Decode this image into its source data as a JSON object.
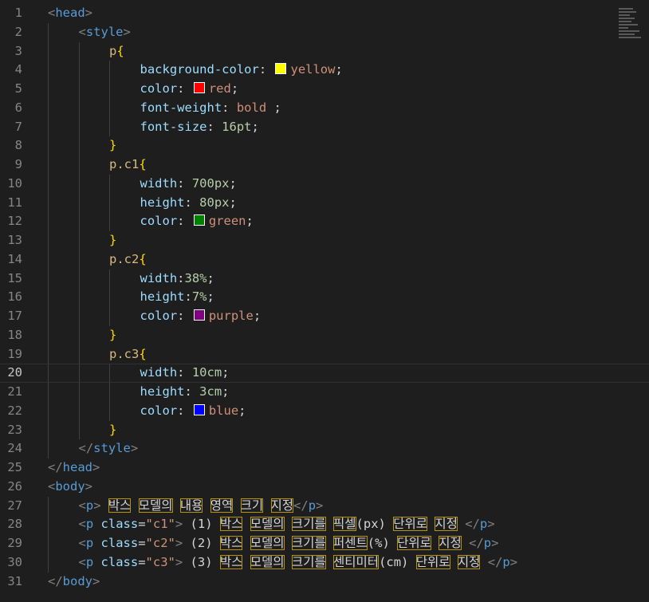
{
  "editor": {
    "lines": [
      {
        "n": "1",
        "indent": 0,
        "tokens": [
          {
            "t": "<",
            "c": "brk"
          },
          {
            "t": "head",
            "c": "tag"
          },
          {
            "t": ">",
            "c": "brk"
          }
        ]
      },
      {
        "n": "2",
        "indent": 1,
        "tokens": [
          {
            "t": "<",
            "c": "brk"
          },
          {
            "t": "style",
            "c": "tag"
          },
          {
            "t": ">",
            "c": "brk"
          }
        ]
      },
      {
        "n": "3",
        "indent": 2,
        "tokens": [
          {
            "t": "p",
            "c": "sel"
          },
          {
            "t": "{",
            "c": "brace"
          }
        ]
      },
      {
        "n": "4",
        "indent": 3,
        "tokens": [
          {
            "t": "background-color",
            "c": "prop"
          },
          {
            "t": ": ",
            "c": "txt"
          },
          {
            "swatch": "#ffff00",
            "name": "yellow-swatch"
          },
          {
            "t": "yellow",
            "c": "val"
          },
          {
            "t": ";",
            "c": "txt"
          }
        ]
      },
      {
        "n": "5",
        "indent": 3,
        "tokens": [
          {
            "t": "color",
            "c": "prop"
          },
          {
            "t": ": ",
            "c": "txt"
          },
          {
            "swatch": "#ff0000",
            "name": "red-swatch"
          },
          {
            "t": "red",
            "c": "val"
          },
          {
            "t": ";",
            "c": "txt"
          }
        ]
      },
      {
        "n": "6",
        "indent": 3,
        "tokens": [
          {
            "t": "font-weight",
            "c": "prop"
          },
          {
            "t": ": ",
            "c": "txt"
          },
          {
            "t": "bold",
            "c": "val"
          },
          {
            "t": " ;",
            "c": "txt"
          }
        ]
      },
      {
        "n": "7",
        "indent": 3,
        "tokens": [
          {
            "t": "font-size",
            "c": "prop"
          },
          {
            "t": ": ",
            "c": "txt"
          },
          {
            "t": "16pt",
            "c": "num"
          },
          {
            "t": ";",
            "c": "txt"
          }
        ]
      },
      {
        "n": "8",
        "indent": 2,
        "tokens": [
          {
            "t": "}",
            "c": "brace"
          }
        ]
      },
      {
        "n": "9",
        "indent": 2,
        "tokens": [
          {
            "t": "p.c1",
            "c": "sel"
          },
          {
            "t": "{",
            "c": "brace"
          }
        ]
      },
      {
        "n": "10",
        "indent": 3,
        "tokens": [
          {
            "t": "width",
            "c": "prop"
          },
          {
            "t": ": ",
            "c": "txt"
          },
          {
            "t": "700px",
            "c": "num"
          },
          {
            "t": ";",
            "c": "txt"
          }
        ]
      },
      {
        "n": "11",
        "indent": 3,
        "tokens": [
          {
            "t": "height",
            "c": "prop"
          },
          {
            "t": ": ",
            "c": "txt"
          },
          {
            "t": "80px",
            "c": "num"
          },
          {
            "t": ";",
            "c": "txt"
          }
        ]
      },
      {
        "n": "12",
        "indent": 3,
        "tokens": [
          {
            "t": "color",
            "c": "prop"
          },
          {
            "t": ": ",
            "c": "txt"
          },
          {
            "swatch": "#008000",
            "name": "green-swatch"
          },
          {
            "t": "green",
            "c": "val"
          },
          {
            "t": ";",
            "c": "txt"
          }
        ]
      },
      {
        "n": "13",
        "indent": 2,
        "tokens": [
          {
            "t": "}",
            "c": "brace"
          }
        ]
      },
      {
        "n": "14",
        "indent": 2,
        "tokens": [
          {
            "t": "p.c2",
            "c": "sel"
          },
          {
            "t": "{",
            "c": "brace"
          }
        ]
      },
      {
        "n": "15",
        "indent": 3,
        "tokens": [
          {
            "t": "width",
            "c": "prop"
          },
          {
            "t": ":",
            "c": "txt"
          },
          {
            "t": "38%",
            "c": "num"
          },
          {
            "t": ";",
            "c": "txt"
          }
        ]
      },
      {
        "n": "16",
        "indent": 3,
        "tokens": [
          {
            "t": "height",
            "c": "prop"
          },
          {
            "t": ":",
            "c": "txt"
          },
          {
            "t": "7%",
            "c": "num"
          },
          {
            "t": ";",
            "c": "txt"
          }
        ]
      },
      {
        "n": "17",
        "indent": 3,
        "tokens": [
          {
            "t": "color",
            "c": "prop"
          },
          {
            "t": ": ",
            "c": "txt"
          },
          {
            "swatch": "#800080",
            "name": "purple-swatch"
          },
          {
            "t": "purple",
            "c": "val"
          },
          {
            "t": ";",
            "c": "txt"
          }
        ]
      },
      {
        "n": "18",
        "indent": 2,
        "tokens": [
          {
            "t": "}",
            "c": "brace"
          }
        ]
      },
      {
        "n": "19",
        "indent": 2,
        "tokens": [
          {
            "t": "p.c3",
            "c": "sel"
          },
          {
            "t": "{",
            "c": "brace"
          }
        ]
      },
      {
        "n": "20",
        "indent": 3,
        "current": true,
        "tokens": [
          {
            "t": "width",
            "c": "prop"
          },
          {
            "t": ": ",
            "c": "txt"
          },
          {
            "t": "10cm",
            "c": "num"
          },
          {
            "t": ";",
            "c": "txt"
          }
        ]
      },
      {
        "n": "21",
        "indent": 3,
        "tokens": [
          {
            "t": "height",
            "c": "prop"
          },
          {
            "t": ": ",
            "c": "txt"
          },
          {
            "t": "3cm",
            "c": "num"
          },
          {
            "t": ";",
            "c": "txt"
          }
        ]
      },
      {
        "n": "22",
        "indent": 3,
        "tokens": [
          {
            "t": "color",
            "c": "prop"
          },
          {
            "t": ": ",
            "c": "txt"
          },
          {
            "swatch": "#0000ff",
            "name": "blue-swatch"
          },
          {
            "t": "blue",
            "c": "val"
          },
          {
            "t": ";",
            "c": "txt"
          }
        ]
      },
      {
        "n": "23",
        "indent": 2,
        "tokens": [
          {
            "t": "}",
            "c": "brace"
          }
        ]
      },
      {
        "n": "24",
        "indent": 1,
        "tokens": [
          {
            "t": "</",
            "c": "brk"
          },
          {
            "t": "style",
            "c": "tag"
          },
          {
            "t": ">",
            "c": "brk"
          }
        ]
      },
      {
        "n": "25",
        "indent": 0,
        "tokens": [
          {
            "t": "</",
            "c": "brk"
          },
          {
            "t": "head",
            "c": "tag"
          },
          {
            "t": ">",
            "c": "brk"
          }
        ]
      },
      {
        "n": "26",
        "indent": 0,
        "tokens": [
          {
            "t": "<",
            "c": "brk"
          },
          {
            "t": "body",
            "c": "tag"
          },
          {
            "t": ">",
            "c": "brk"
          }
        ]
      },
      {
        "n": "27",
        "indent": 1,
        "tokens": [
          {
            "t": "<",
            "c": "brk"
          },
          {
            "t": "p",
            "c": "tag"
          },
          {
            "t": ">",
            "c": "brk"
          },
          {
            "t": " ",
            "c": "txt"
          },
          {
            "t": "박스",
            "c": "txt",
            "hl": true
          },
          {
            "t": " ",
            "c": "txt"
          },
          {
            "t": "모델의",
            "c": "txt",
            "hl": true
          },
          {
            "t": " ",
            "c": "txt"
          },
          {
            "t": "내용",
            "c": "txt",
            "hl": true
          },
          {
            "t": " ",
            "c": "txt"
          },
          {
            "t": "영역",
            "c": "txt",
            "hl": true
          },
          {
            "t": " ",
            "c": "txt"
          },
          {
            "t": "크기",
            "c": "txt",
            "hl": true
          },
          {
            "t": " ",
            "c": "txt"
          },
          {
            "t": "지정",
            "c": "txt",
            "hl": true
          },
          {
            "t": "</",
            "c": "brk"
          },
          {
            "t": "p",
            "c": "tag"
          },
          {
            "t": ">",
            "c": "brk"
          }
        ]
      },
      {
        "n": "28",
        "indent": 1,
        "tokens": [
          {
            "t": "<",
            "c": "brk"
          },
          {
            "t": "p",
            "c": "tag"
          },
          {
            "t": " ",
            "c": "txt"
          },
          {
            "t": "class",
            "c": "attr"
          },
          {
            "t": "=",
            "c": "txt"
          },
          {
            "t": "\"c1\"",
            "c": "str"
          },
          {
            "t": ">",
            "c": "brk"
          },
          {
            "t": " (1) ",
            "c": "txt"
          },
          {
            "t": "박스",
            "c": "txt",
            "hl": true
          },
          {
            "t": " ",
            "c": "txt"
          },
          {
            "t": "모델의",
            "c": "txt",
            "hl": true
          },
          {
            "t": " ",
            "c": "txt"
          },
          {
            "t": "크기를",
            "c": "txt",
            "hl": true
          },
          {
            "t": " ",
            "c": "txt"
          },
          {
            "t": "픽셀",
            "c": "txt",
            "hl": true
          },
          {
            "t": "(px) ",
            "c": "txt"
          },
          {
            "t": "단위로",
            "c": "txt",
            "hl": true
          },
          {
            "t": " ",
            "c": "txt"
          },
          {
            "t": "지정",
            "c": "txt",
            "hl": true
          },
          {
            "t": " ",
            "c": "txt"
          },
          {
            "t": "</",
            "c": "brk"
          },
          {
            "t": "p",
            "c": "tag"
          },
          {
            "t": ">",
            "c": "brk"
          }
        ]
      },
      {
        "n": "29",
        "indent": 1,
        "tokens": [
          {
            "t": "<",
            "c": "brk"
          },
          {
            "t": "p",
            "c": "tag"
          },
          {
            "t": " ",
            "c": "txt"
          },
          {
            "t": "class",
            "c": "attr"
          },
          {
            "t": "=",
            "c": "txt"
          },
          {
            "t": "\"c2\"",
            "c": "str"
          },
          {
            "t": ">",
            "c": "brk"
          },
          {
            "t": " (2) ",
            "c": "txt"
          },
          {
            "t": "박스",
            "c": "txt",
            "hl": true
          },
          {
            "t": " ",
            "c": "txt"
          },
          {
            "t": "모델의",
            "c": "txt",
            "hl": true
          },
          {
            "t": " ",
            "c": "txt"
          },
          {
            "t": "크기를",
            "c": "txt",
            "hl": true
          },
          {
            "t": " ",
            "c": "txt"
          },
          {
            "t": "퍼센트",
            "c": "txt",
            "hl": true
          },
          {
            "t": "(%) ",
            "c": "txt"
          },
          {
            "t": "단위로",
            "c": "txt",
            "hl": true
          },
          {
            "t": " ",
            "c": "txt"
          },
          {
            "t": "지정",
            "c": "txt",
            "hl": true
          },
          {
            "t": " ",
            "c": "txt"
          },
          {
            "t": "</",
            "c": "brk"
          },
          {
            "t": "p",
            "c": "tag"
          },
          {
            "t": ">",
            "c": "brk"
          }
        ]
      },
      {
        "n": "30",
        "indent": 1,
        "tokens": [
          {
            "t": "<",
            "c": "brk"
          },
          {
            "t": "p",
            "c": "tag"
          },
          {
            "t": " ",
            "c": "txt"
          },
          {
            "t": "class",
            "c": "attr"
          },
          {
            "t": "=",
            "c": "txt"
          },
          {
            "t": "\"c3\"",
            "c": "str"
          },
          {
            "t": ">",
            "c": "brk"
          },
          {
            "t": " (3) ",
            "c": "txt"
          },
          {
            "t": "박스",
            "c": "txt",
            "hl": true
          },
          {
            "t": " ",
            "c": "txt"
          },
          {
            "t": "모델의",
            "c": "txt",
            "hl": true
          },
          {
            "t": " ",
            "c": "txt"
          },
          {
            "t": "크기를",
            "c": "txt",
            "hl": true
          },
          {
            "t": " ",
            "c": "txt"
          },
          {
            "t": "센티미터",
            "c": "txt",
            "hl": true
          },
          {
            "t": "(cm) ",
            "c": "txt"
          },
          {
            "t": "단위로",
            "c": "txt",
            "hl": true
          },
          {
            "t": " ",
            "c": "txt"
          },
          {
            "t": "지정",
            "c": "txt",
            "hl": true
          },
          {
            "t": " ",
            "c": "txt"
          },
          {
            "t": "</",
            "c": "brk"
          },
          {
            "t": "p",
            "c": "tag"
          },
          {
            "t": ">",
            "c": "brk"
          }
        ]
      },
      {
        "n": "31",
        "indent": 0,
        "tokens": [
          {
            "t": "</",
            "c": "brk"
          },
          {
            "t": "body",
            "c": "tag"
          },
          {
            "t": ">",
            "c": "brk"
          }
        ]
      }
    ]
  },
  "colors": {
    "background": "#1e1e1e",
    "line_number": "#858585",
    "tag": "#569cd6",
    "selector": "#d7ba7d",
    "brace": "#ffd700",
    "property": "#9cdcfe",
    "value": "#ce9178",
    "number": "#b5cea8",
    "unicode_highlight": "#b89500"
  }
}
